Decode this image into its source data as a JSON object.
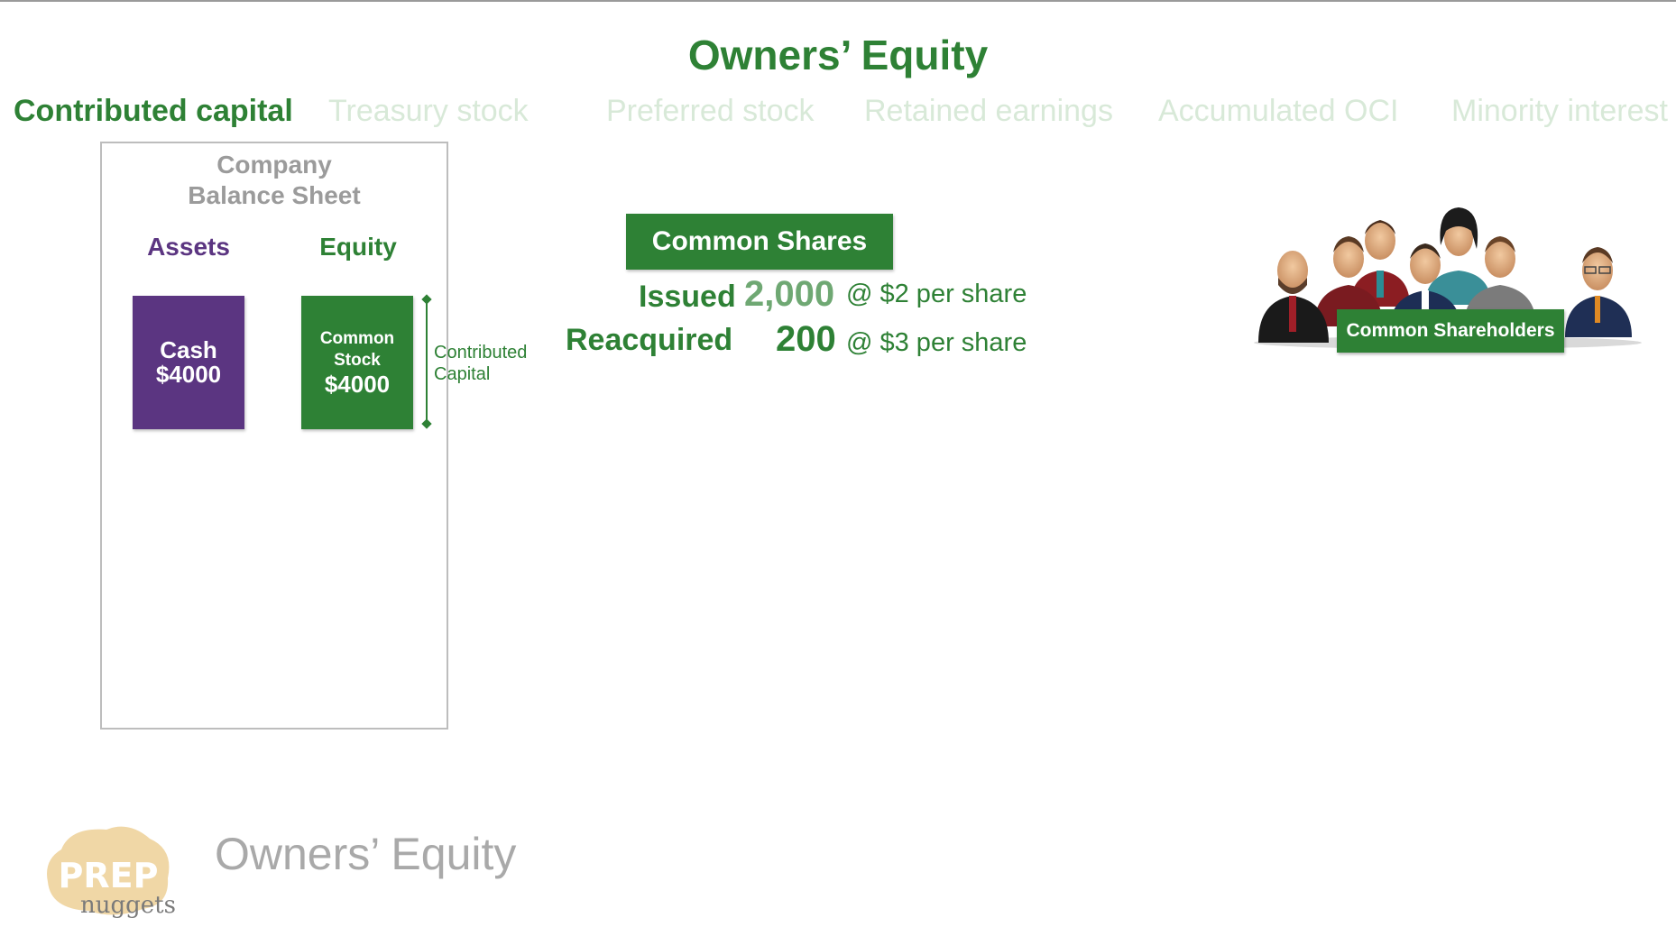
{
  "slide": {
    "title": "Owners’ Equity",
    "tabs": [
      {
        "label": "Contributed capital",
        "active": true
      },
      {
        "label": "Treasury stock",
        "active": false
      },
      {
        "label": "Preferred stock",
        "active": false
      },
      {
        "label": "Retained earnings",
        "active": false
      },
      {
        "label": "Accumulated OCI",
        "active": false
      },
      {
        "label": "Minority interest",
        "active": false
      }
    ]
  },
  "balance_sheet": {
    "title_line1": "Company",
    "title_line2": "Balance Sheet",
    "assets_label": "Assets",
    "equity_label": "Equity",
    "cash_label": "Cash",
    "cash_value": "$4000",
    "common_stock_line1": "Common",
    "common_stock_line2": "Stock",
    "common_stock_value": "$4000",
    "bracket_line1": "Contributed",
    "bracket_line2": "Capital"
  },
  "shares": {
    "heading": "Common Shares",
    "issued_label": "Issued",
    "issued_count": "2,000",
    "issued_price": "@ $2 per share",
    "reacquired_label": "Reacquired",
    "reacquired_count": "200",
    "reacquired_price": "@ $3 per share"
  },
  "shareholders": {
    "label": "Common Shareholders",
    "icon": "people-group-icon"
  },
  "footer": {
    "logo_top": "PREP",
    "logo_bottom": "nuggets",
    "title": "Owners’ Equity"
  },
  "colors": {
    "green": "#2e8135",
    "purple": "#5b3581",
    "gray": "#9b9b9b",
    "tab_dim": "#d8e9d8"
  }
}
